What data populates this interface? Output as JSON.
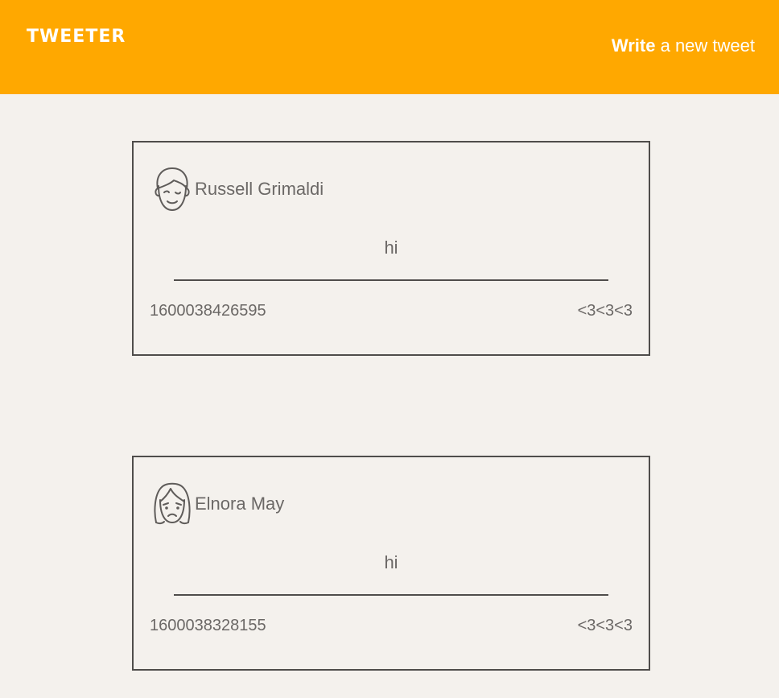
{
  "header": {
    "logo": "TWEETER",
    "write_strong": "Write",
    "write_rest": " a new tweet",
    "background_color": "#ffa800"
  },
  "tweets": [
    {
      "avatar_icon": "smiling-man-avatar-icon",
      "username": "Russell Grimaldi",
      "content": "hi",
      "timestamp": "1600038426595",
      "likes": "<3<3<3"
    },
    {
      "avatar_icon": "sad-woman-avatar-icon",
      "username": "Elnora May",
      "content": "hi",
      "timestamp": "1600038328155",
      "likes": "<3<3<3"
    }
  ],
  "colors": {
    "page_background": "#f4f1ed",
    "text": "#6b6866",
    "border": "#4f4d4b"
  }
}
